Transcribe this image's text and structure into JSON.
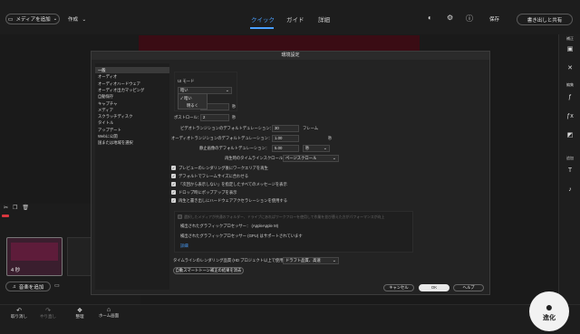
{
  "toolbar": {
    "add_media": "メディアを追加",
    "create": "作成",
    "tabs": [
      "クイック",
      "ガイド",
      "詳細"
    ],
    "save": "保存",
    "export_share": "書き出しと共有"
  },
  "right_panel": {
    "labels": [
      "補正",
      "編集",
      "追加"
    ]
  },
  "timeline": {
    "clip_duration": "4 秒",
    "add_audio": "音楽を追加"
  },
  "bottom": {
    "undo": "取り消し",
    "redo": "やり直し",
    "organize": "整理",
    "home": "ホーム画面"
  },
  "dialog": {
    "title": "環境設定",
    "categories": [
      "一般",
      "オーディオ",
      "オーディオハードウェア",
      "オーディオ出力マッピング",
      "自動保存",
      "キャプチャ",
      "メディア",
      "スクラッチディスク",
      "タイトル",
      "アップデート",
      "Webに公開",
      "国または地域を選択"
    ],
    "selected_category": "一般",
    "ui_mode_label": "UI モード",
    "ui_mode_value": "暗い",
    "ui_mode_options": [
      "暗い",
      "明るく"
    ],
    "pre_roll_unit": "秒",
    "post_roll_label": "ポストロール：",
    "post_roll_value": "2",
    "post_roll_unit": "秒",
    "video_transition_label": "ビデオトランジションのデフォルトデュレーション：",
    "video_transition_value": "30",
    "video_transition_unit": "フレーム",
    "audio_transition_label": "オーディオトランジションのデフォルトデュレーション：",
    "audio_transition_value": "1.00",
    "audio_transition_unit": "秒",
    "still_image_label": "静止画像のデフォルトデュレーション：",
    "still_image_value": "5.00",
    "still_image_unit": "秒",
    "timeline_scroll_label": "再生時のタイムラインスクロール：",
    "timeline_scroll_value": "ページスクロール",
    "checkboxes": [
      "プレビューのレンダリング後にワークエリアを再生",
      "デフォルトでフレームサイズに合わせる",
      "「次回から表示しない」を指定したすべてのメッセージを表示",
      "ドロップ時にポップアップを表示",
      "再生と書き出しにハードウェアアクセラレーションを使用する"
    ],
    "disabled_option": "選択したメディアが共通のフォルダー、ドライブにあればワークフローを使用して作業を並び替えた方がパフォーマンスが向上",
    "gpu_detected_label": "検出されたグラフィックプロセッサー：",
    "gpu_detected_value": "(AppleApple M)",
    "gpu_supported": "検出されたグラフィックプロセッサー (GPU) はサポートされています",
    "details_link": "詳細",
    "render_quality_label": "タイムラインのレンダリング品質 (HD プロジェクト以上で使用)：",
    "render_quality_value": "ドラフト品質、高速",
    "reset_smart_tone": "自動スマートトーン補正の結果を消去",
    "cancel": "キャンセル",
    "ok": "OK",
    "help": "ヘルプ"
  },
  "watermark": {
    "text": "進化"
  }
}
